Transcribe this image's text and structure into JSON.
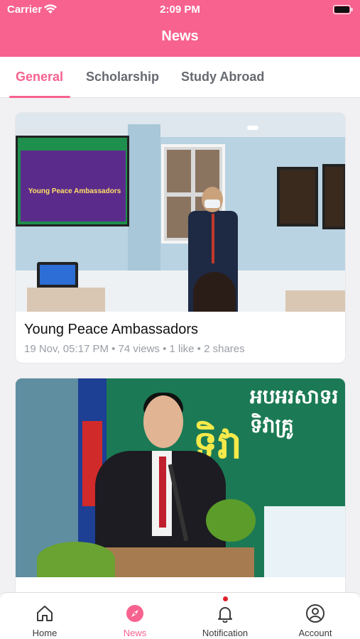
{
  "status_bar": {
    "carrier": "Carrier",
    "time": "2:09 PM"
  },
  "header": {
    "title": "News"
  },
  "tabs": [
    {
      "label": "General",
      "active": true
    },
    {
      "label": "Scholarship",
      "active": false
    },
    {
      "label": "Study Abroad",
      "active": false
    }
  ],
  "posts": [
    {
      "title": "Young Peace Ambassadors",
      "meta": "19 Nov, 05:17 PM • 74 views • 1 like • 2 shares",
      "image_text": "Young Peace Ambassadors"
    },
    {
      "title": "",
      "meta": "",
      "image_text": "អបអរសាទរ ទិវាគ្រូ"
    }
  ],
  "bottom_nav": {
    "items": [
      {
        "label": "Home",
        "icon": "home-icon",
        "active": false
      },
      {
        "label": "News",
        "icon": "compass-icon",
        "active": true
      },
      {
        "label": "Notification",
        "icon": "bell-icon",
        "active": false,
        "badge": true
      },
      {
        "label": "Account",
        "icon": "account-icon",
        "active": false
      }
    ]
  },
  "colors": {
    "accent": "#f7628f",
    "inactive_tab": "#666a70",
    "meta_text": "#9a9ea5",
    "badge": "#e0202a"
  }
}
